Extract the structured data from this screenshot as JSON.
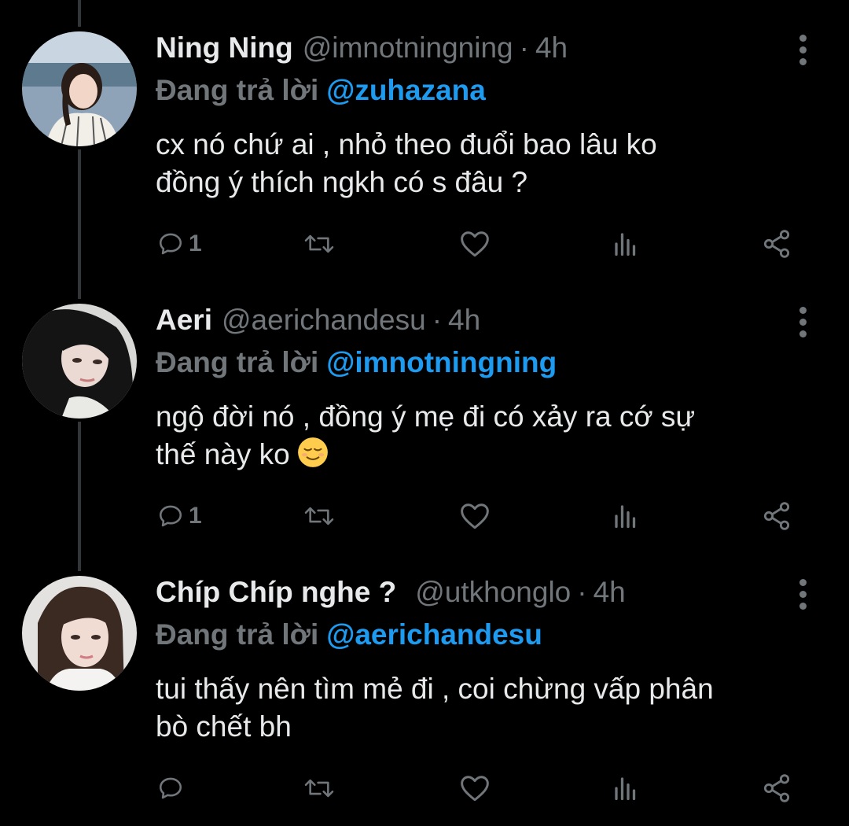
{
  "tweets": [
    {
      "name": "Ning Ning",
      "handle": "@imnotningning",
      "separator": "·",
      "time": "4h",
      "replying_label": "Đang trả lời",
      "replying_to": "@zuhazana",
      "text_lines": [
        "cx nó chứ ai , nhỏ theo đuổi bao lâu ko",
        "đồng ý thích ngkh có s đâu ?"
      ],
      "reply_count": "1",
      "retweet_count": "",
      "like_count": ""
    },
    {
      "name": "Aeri",
      "handle": "@aerichandesu",
      "separator": "·",
      "time": "4h",
      "replying_label": "Đang trả lời",
      "replying_to": "@imnotningning",
      "text_lines": [
        "ngộ đời nó , đồng ý mẹ đi có xảy ra cớ sự",
        "thế này ko"
      ],
      "emoji": "relieved-face-emoji",
      "reply_count": "1",
      "retweet_count": "",
      "like_count": ""
    },
    {
      "name": "Chíp Chíp nghe ?",
      "handle": "@utkhonglo",
      "separator": "·",
      "time": "4h",
      "replying_label": "Đang trả lời",
      "replying_to": "@aerichandesu",
      "text_lines": [
        "tui thấy nên tìm mẻ đi , coi chừng vấp phân",
        "bò chết bh"
      ],
      "reply_count": "",
      "retweet_count": "",
      "like_count": ""
    }
  ],
  "icons": {
    "reply": "reply-icon",
    "retweet": "retweet-icon",
    "like": "heart-icon",
    "views": "views-icon",
    "share": "share-icon",
    "more": "more-vertical-icon"
  },
  "colors": {
    "background": "#000000",
    "text_primary": "#e7e9ea",
    "text_secondary": "#71767b",
    "mention": "#1d9bf0",
    "thread_line": "#333639"
  }
}
